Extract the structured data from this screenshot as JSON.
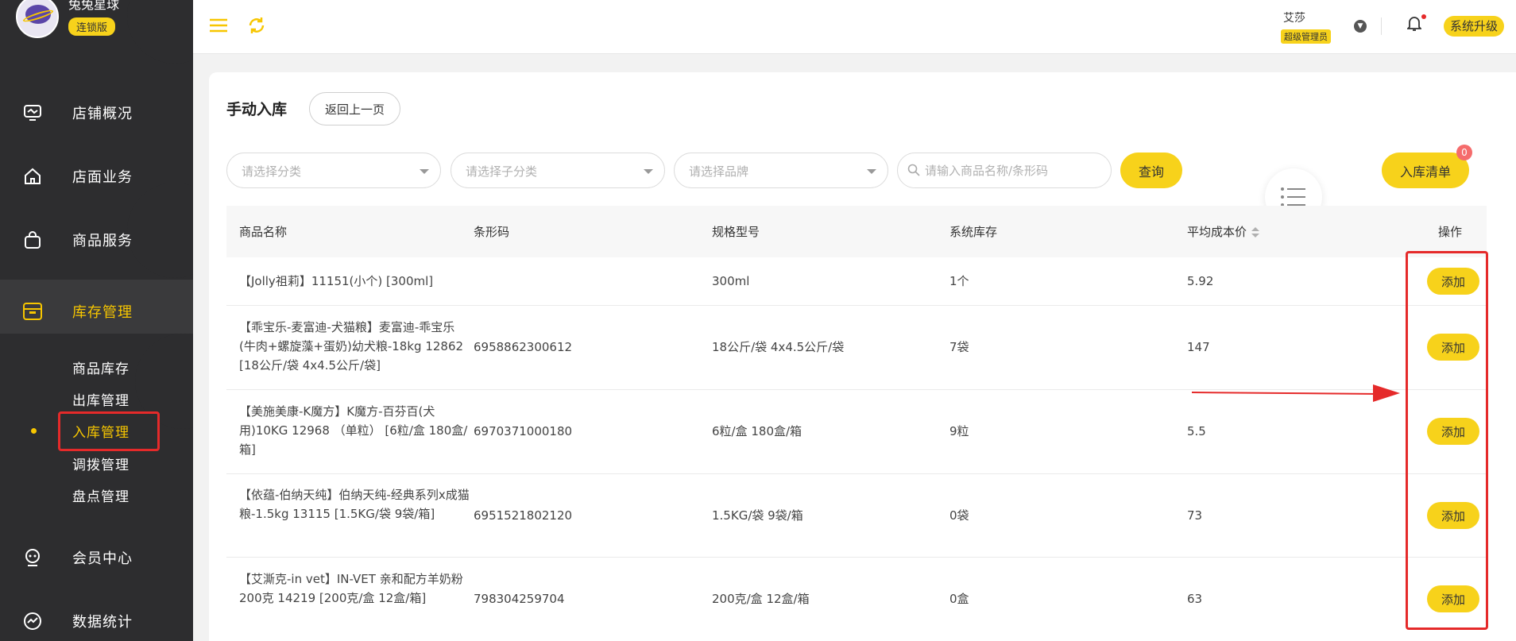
{
  "brand": {
    "name": "兔兔星球",
    "edition": "连锁版"
  },
  "sidebar": {
    "items": [
      {
        "label": "店铺概况",
        "icon": "monitor-icon"
      },
      {
        "label": "店面业务",
        "icon": "home-icon"
      },
      {
        "label": "商品服务",
        "icon": "bag-icon"
      },
      {
        "label": "库存管理",
        "icon": "box-icon",
        "active": true
      },
      {
        "label": "会员中心",
        "icon": "member-icon"
      },
      {
        "label": "数据统计",
        "icon": "chart-icon"
      }
    ],
    "sub_items": [
      {
        "label": "商品库存"
      },
      {
        "label": "出库管理"
      },
      {
        "label": "入库管理",
        "active": true
      },
      {
        "label": "调拨管理"
      },
      {
        "label": "盘点管理"
      }
    ]
  },
  "topbar": {
    "user_name": "艾莎",
    "user_role": "超级管理员",
    "upgrade_label": "系统升级"
  },
  "page": {
    "title": "手动入库",
    "back_label": "返回上一页"
  },
  "filters": {
    "category_placeholder": "请选择分类",
    "subcategory_placeholder": "请选择子分类",
    "brand_placeholder": "请选择品牌",
    "search_placeholder": "请输入商品名称/条形码",
    "query_label": "查询",
    "inbound_list_label": "入库清单",
    "inbound_list_count": "0"
  },
  "table": {
    "headers": {
      "name": "商品名称",
      "barcode": "条形码",
      "spec": "规格型号",
      "stock": "系统库存",
      "cost": "平均成本价",
      "ops": "操作"
    },
    "add_label": "添加",
    "rows": [
      {
        "name": "【Jolly祖莉】11151(小个) [300ml]",
        "barcode": "",
        "spec": "300ml",
        "stock": "1个",
        "cost": "5.92"
      },
      {
        "name": "【乖宝乐-麦富迪-犬猫粮】麦富迪-乖宝乐(牛肉+螺旋藻+蛋奶)幼犬粮-18kg 12862 [18公斤/袋 4x4.5公斤/袋]",
        "barcode": "6958862300612",
        "spec": "18公斤/袋 4x4.5公斤/袋",
        "stock": "7袋",
        "cost": "147"
      },
      {
        "name": "【美施美康-K魔方】K魔方-百芬百(犬用)10KG 12968 （单粒） [6粒/盒 180盒/箱]",
        "barcode": "6970371000180",
        "spec": "6粒/盒 180盒/箱",
        "stock": "9粒",
        "cost": "5.5"
      },
      {
        "name": "【依蕴-伯纳天纯】伯纳天纯-经典系列x成猫粮-1.5kg 13115 [1.5KG/袋 9袋/箱]",
        "barcode": "6951521802120",
        "spec": "1.5KG/袋 9袋/箱",
        "stock": "0袋",
        "cost": "73"
      },
      {
        "name": "【艾澌克-in vet】IN-VET 亲和配方羊奶粉 200克 14219 [200克/盒 12盒/箱]",
        "barcode": "798304259704",
        "spec": "200克/盒 12盒/箱",
        "stock": "0盒",
        "cost": "63"
      }
    ]
  },
  "colors": {
    "accent": "#f7d21b",
    "sidebar": "#2d2d2f",
    "annotation": "#e52a2a"
  }
}
